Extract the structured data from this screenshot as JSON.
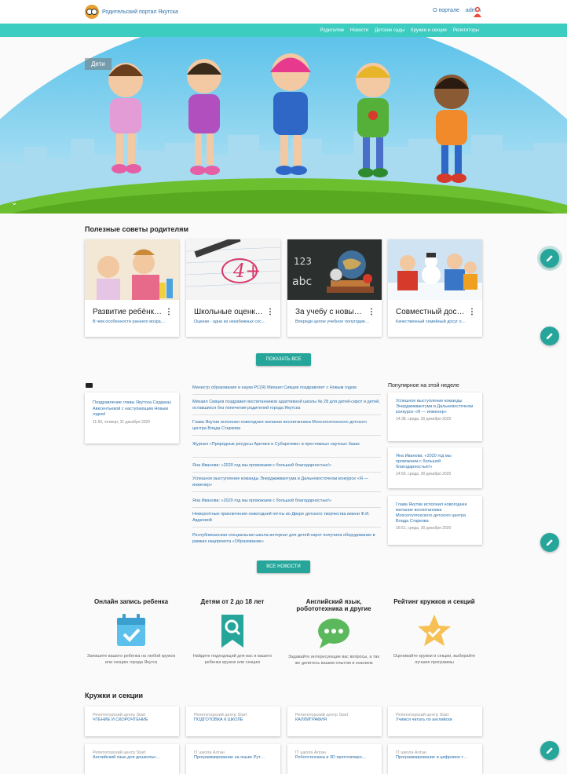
{
  "header": {
    "title": "Родительский портал Якутска",
    "about": "О портале",
    "user": "admin"
  },
  "nav": [
    "Родителям",
    "Новости",
    "Детские сады",
    "Кружки и секции",
    "Репетиторы"
  ],
  "hero": {
    "label": "Дети"
  },
  "tips": {
    "title": "Полезные советы родителям",
    "cards": [
      {
        "title": "Развитие ребёнк…",
        "desc": "В чем особенности раннего возра…"
      },
      {
        "title": "Школьные оценк…",
        "desc": "Оценки - одна из неизбежных сос…"
      },
      {
        "title": "За учебу с новы…",
        "desc": "Впереди целое учебное полугодие…"
      },
      {
        "title": "Совместный дос…",
        "desc": "Качественный семейный досуг о…"
      }
    ],
    "button": "ПОКАЗАТЬ ВСЕ"
  },
  "featured": {
    "text": "Поздравление главы Якутска Сарданы Авксентьевой с наступающим Новым годом!",
    "date": "11:56, четверг, 31 декабря 2020"
  },
  "news": [
    "Министр образования и науки РС(Я) Михаил Сивцев поздравляет с Новым годом",
    "Михаил Сивцев поздравил воспитанников адаптивной школы № 28 для детей-сирот и детей, оставшихся без попечения родителей города Якутска",
    "Глава Якутии исполнил новогоднее желание воспитанника Мохсоголлохского детского центра Влада Старкова",
    "Журнал «Природные ресурсы Арктики и Субарктики» в престижных научных базах",
    "Яна Иванова: «2020 год мы провожаем с большой благодарностью!»",
    "Успешное выступление команды Энерджиквантума в Дальневосточном конкурсе «Я — инженер»",
    "Яна Иванова: «2020 год мы провожаем с большой благодарностью!»",
    "Невероятные приключения новогодней почты во Дворе детского творчества имени Ф.И. Авдеевой",
    "Республиканская специальная школа-интернат для детей-сирот получила оборудование в рамках нацпроекта «Образование»"
  ],
  "news_button": "ВСЕ НОВОСТИ",
  "popular": {
    "title": "Популярное на этой неделе",
    "items": [
      {
        "text": "Успешное выступление команды Энерджиквантума в Дальневосточном конкурсе «Я — инженер»",
        "date": "14:38, среда, 30 декабря 2020"
      },
      {
        "text": "Яна Иванова: «2020 год мы провожаем с большой благодарностью!»",
        "date": "14:50, среда, 30 декабря 2020"
      },
      {
        "text": "Глава Якутии исполнил новогоднее желание воспитанника Мохсоголлохского детского центра Влада Старкова",
        "date": "16:51, среда, 30 декабря 2020"
      }
    ]
  },
  "features": [
    {
      "title": "Онлайн запись ребенка",
      "desc": "Запишите вашего ребенка на любой кружок или секцию города Якутск"
    },
    {
      "title": "Детям от 2 до 18 лет",
      "desc": "Найдите подходящий для вас и вашего ребенка кружок или секцию"
    },
    {
      "title": "Английский язык, робототехника и другие",
      "desc": "Задавайте интересующие вас вопросы, а так же делитесь вашим опытом и знанием"
    },
    {
      "title": "Рейтинг кружков и секций",
      "desc": "Оценивайте кружки и секции, выбирайте лучшие программы"
    }
  ],
  "clubs": {
    "title": "Кружки и секции",
    "items": [
      {
        "org": "Репетиторский центр Start",
        "name": "ЧТЕНИЕ И СКОРОЧТЕНИЕ"
      },
      {
        "org": "Репетиторский центр Start",
        "name": "ПОДГОТОВКА К ШКОЛЕ"
      },
      {
        "org": "Репетиторский центр Start",
        "name": "КАЛЛИГРАФИЯ"
      },
      {
        "org": "Репетиторский центр Start",
        "name": "Учимся читать по английски"
      },
      {
        "org": "Репетиторский центр Start",
        "name": "Английский язык для дошкольн…"
      },
      {
        "org": "IT школа Алган",
        "name": "Программирование на языке Рут…"
      },
      {
        "org": "IT школа Алган",
        "name": "Робототехника и 3D прототипиро…"
      },
      {
        "org": "IT школа Алган",
        "name": "Программирование и цифровое т…"
      }
    ]
  }
}
